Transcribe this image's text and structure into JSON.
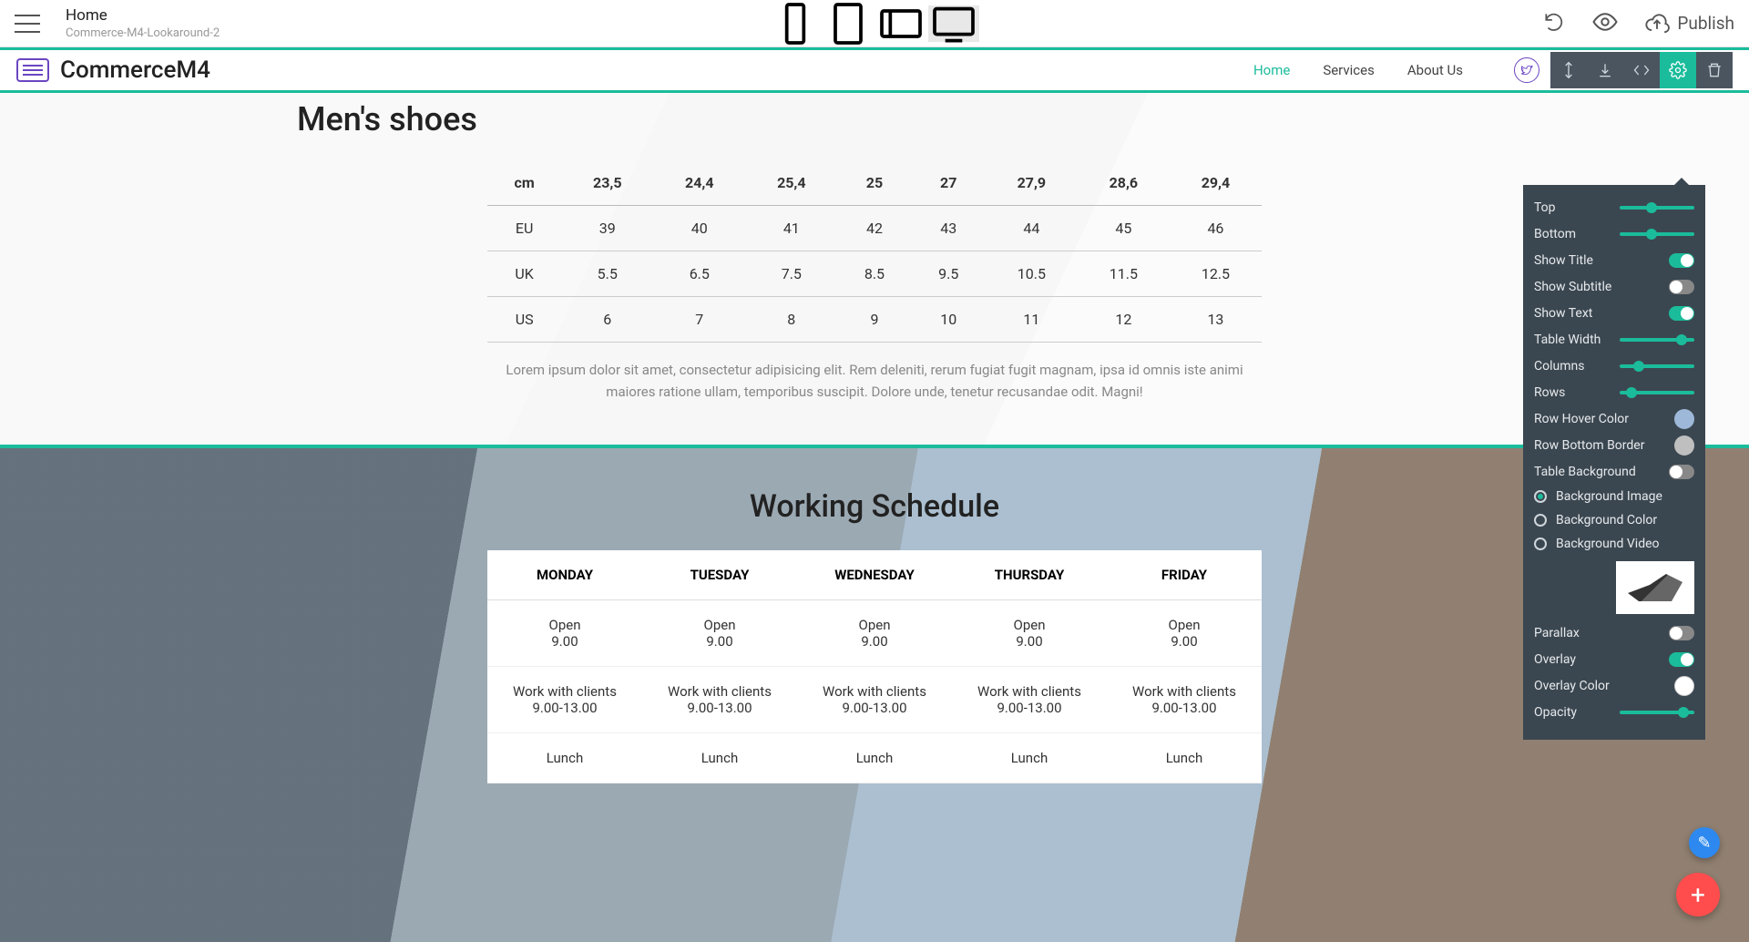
{
  "topbar": {
    "title": "Home",
    "subtitle": "Commerce-M4-Lookaround-2",
    "publish": "Publish"
  },
  "siteheader": {
    "brand": "CommerceM4",
    "nav": [
      "Home",
      "Services",
      "About Us"
    ],
    "nav_active": 0
  },
  "section1": {
    "title": "Men's shoes",
    "headers": [
      "cm",
      "23,5",
      "24,4",
      "25,4",
      "25",
      "27",
      "27,9",
      "28,6",
      "29,4"
    ],
    "rows": [
      [
        "EU",
        "39",
        "40",
        "41",
        "42",
        "43",
        "44",
        "45",
        "46"
      ],
      [
        "UK",
        "5.5",
        "6.5",
        "7.5",
        "8.5",
        "9.5",
        "10.5",
        "11.5",
        "12.5"
      ],
      [
        "US",
        "6",
        "7",
        "8",
        "9",
        "10",
        "11",
        "12",
        "13"
      ]
    ],
    "lorem": "Lorem ipsum dolor sit amet, consectetur adipisicing elit. Rem deleniti, rerum fugiat fugit magnam, ipsa id omnis iste animi maiores ratione ullam, temporibus suscipit. Dolore unde, tenetur recusandae odit. Magni!"
  },
  "section2": {
    "title": "Working Schedule",
    "headers": [
      "MONDAY",
      "TUESDAY",
      "WEDNESDAY",
      "THURSDAY",
      "FRIDAY"
    ],
    "rows": [
      [
        "Open\n9.00",
        "Open\n9.00",
        "Open\n9.00",
        "Open\n9.00",
        "Open\n9.00"
      ],
      [
        "Work with clients\n9.00-13.00",
        "Work with clients\n9.00-13.00",
        "Work with clients\n9.00-13.00",
        "Work with clients\n9.00-13.00",
        "Work with clients\n9.00-13.00"
      ],
      [
        "Lunch",
        "Lunch",
        "Lunch",
        "Lunch",
        "Lunch"
      ]
    ]
  },
  "panel": {
    "sliders": {
      "top": {
        "label": "Top",
        "pos": 35
      },
      "bottom": {
        "label": "Bottom",
        "pos": 35
      },
      "tablewidth": {
        "label": "Table Width",
        "pos": 75
      },
      "columns": {
        "label": "Columns",
        "pos": 18
      },
      "rows": {
        "label": "Rows",
        "pos": 8
      },
      "opacity": {
        "label": "Opacity",
        "pos": 78
      }
    },
    "toggles": {
      "showtitle": {
        "label": "Show Title",
        "on": true
      },
      "showsubtitle": {
        "label": "Show Subtitle",
        "on": false
      },
      "showtext": {
        "label": "Show Text",
        "on": true
      },
      "tablebg": {
        "label": "Table Background",
        "on": false
      },
      "parallax": {
        "label": "Parallax",
        "on": false
      },
      "overlay": {
        "label": "Overlay",
        "on": true
      }
    },
    "colors": {
      "rowhover": {
        "label": "Row Hover Color",
        "hex": "#9db8d8"
      },
      "rowborder": {
        "label": "Row Bottom Border",
        "hex": "#bfbfbf"
      },
      "overlay": {
        "label": "Overlay Color",
        "hex": "#ffffff"
      }
    },
    "radios": {
      "label_img": "Background Image",
      "label_col": "Background Color",
      "label_vid": "Background Video",
      "selected": "img"
    }
  }
}
